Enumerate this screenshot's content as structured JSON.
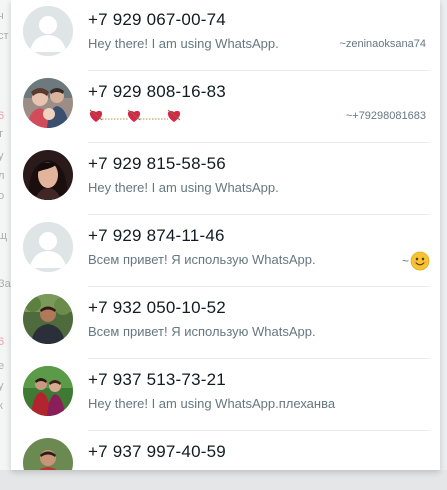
{
  "contacts": [
    {
      "phone": "+7 929 067-00-74",
      "status": "Hey there! I am using WhatsApp.",
      "pushname": "~zeninaoksana74",
      "avatar": "default-avatar-icon"
    },
    {
      "phone": "+7 929 808-16-83",
      "status": "",
      "status_icon": "hearts-and-arrows-emoji",
      "pushname": "~+79298081683",
      "avatar": "family-photo"
    },
    {
      "phone": "+7 929 815-58-56",
      "status": "Hey there! I am using WhatsApp.",
      "avatar": "woman-photo"
    },
    {
      "phone": "+7 929 874-11-46",
      "status": "Всем привет! Я использую WhatsApp.",
      "pushname": "~",
      "pushname_icon": "smiling-face-emoji",
      "avatar": "default-avatar-icon"
    },
    {
      "phone": "+7 932 050-10-52",
      "status": "Всем привет! Я использую WhatsApp.",
      "avatar": "man-outdoor-photo"
    },
    {
      "phone": "+7 937 513-73-21",
      "status": "Hey there! I am using WhatsApp.плеханва",
      "avatar": "two-people-photo"
    },
    {
      "phone": "+7 937 997-40-59",
      "status": "",
      "avatar": "person-red-shirt-photo"
    }
  ],
  "colors": {
    "panel_bg": "#ffffff",
    "phone_text": "#111b21",
    "secondary_text": "#667781",
    "divider": "#e9edef",
    "default_avatar_bg": "#dfe5e7"
  }
}
